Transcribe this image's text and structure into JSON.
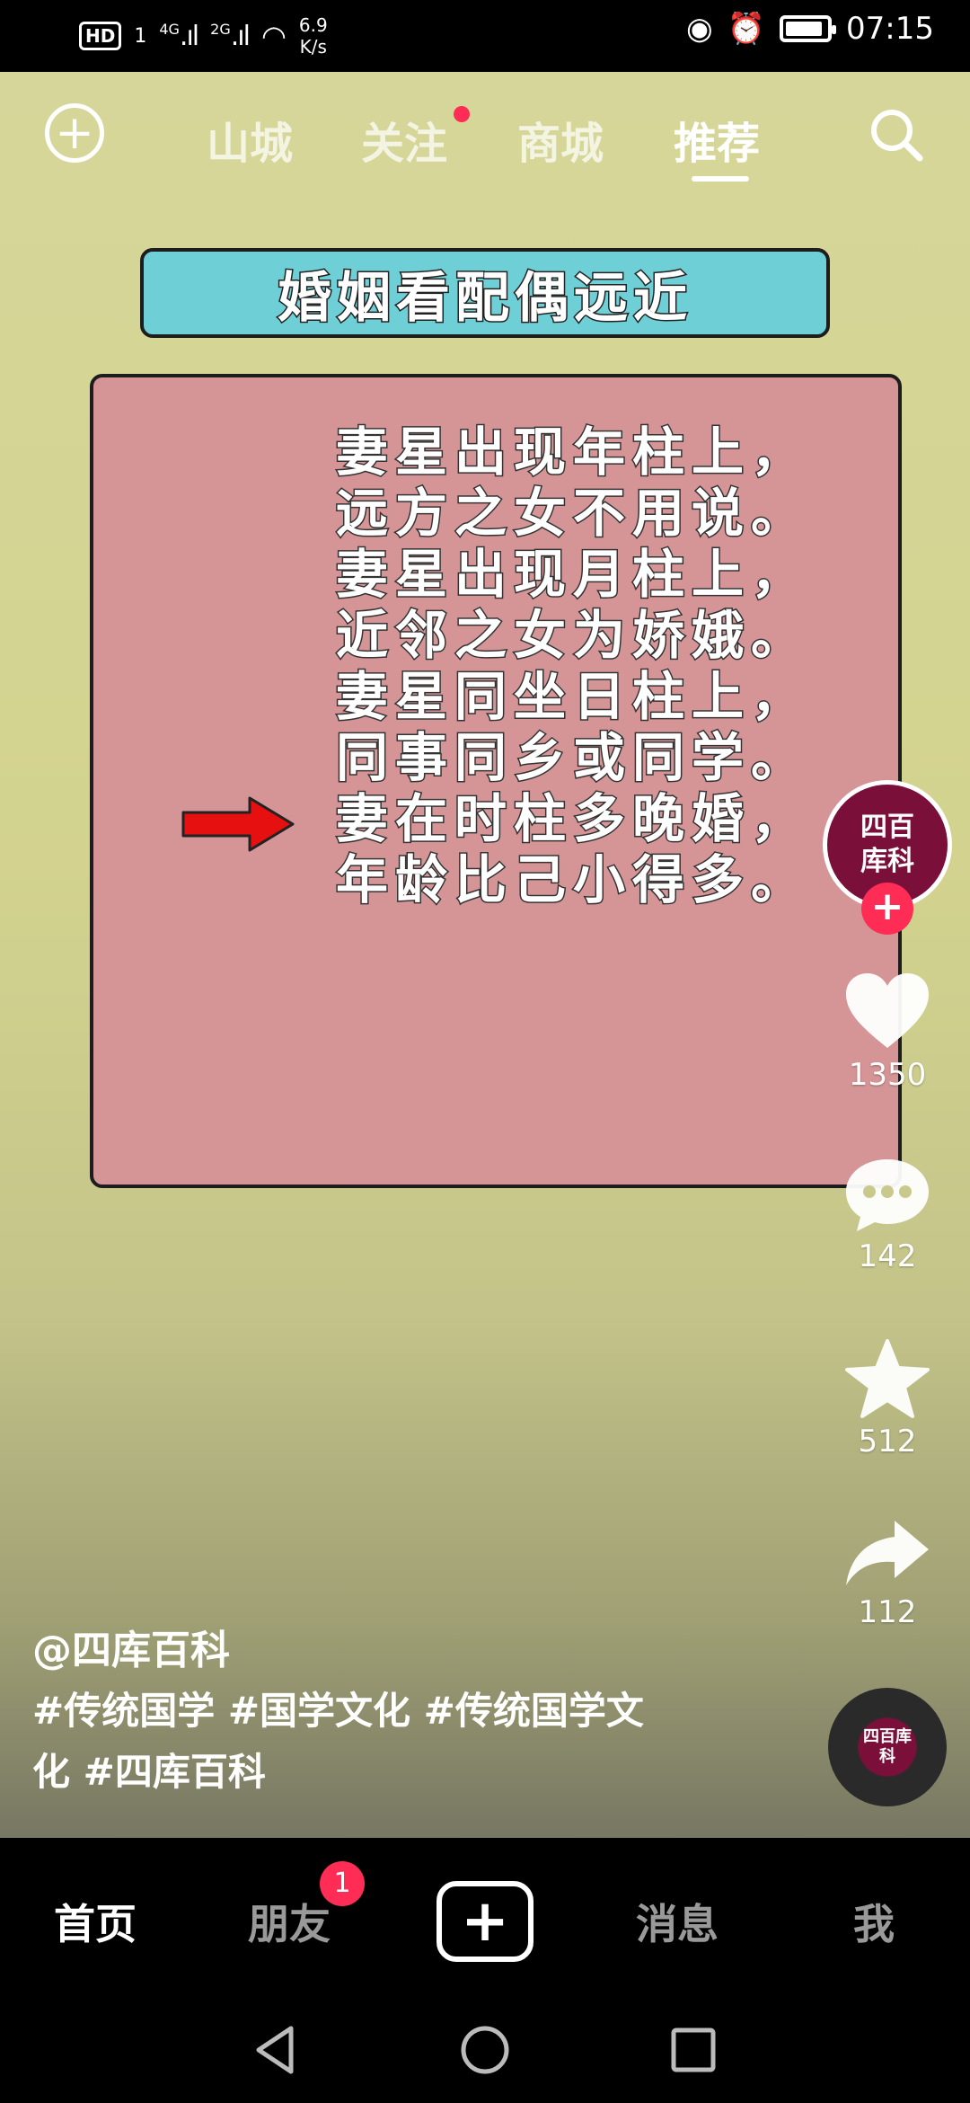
{
  "status_bar": {
    "hd": "HD",
    "sim": "1",
    "sig1": "4G",
    "sig2": "2G",
    "net_rate_value": "6.9",
    "net_rate_unit": "K/s",
    "time": "07:15",
    "battery_level": 0.9
  },
  "top_nav": {
    "tabs": [
      "山城",
      "关注",
      "商城",
      "推荐"
    ],
    "active_tab": "推荐"
  },
  "video": {
    "title": "婚姻看配偶远近",
    "poem_lines": [
      "妻星出现年柱上，",
      "远方之女不用说。",
      "妻星出现月柱上，",
      "近邻之女为娇娥。",
      "妻星同坐日柱上，",
      "同事同乡或同学。",
      "妻在时柱多晚婚，",
      "年龄比己小得多。"
    ]
  },
  "side_actions": {
    "avatar_line1": "四百",
    "avatar_line2": "库科",
    "likes": "1350",
    "comments": "142",
    "favorites": "512",
    "shares": "112"
  },
  "caption": {
    "author": "@四库百科",
    "tags_line1": "#传统国学 #国学文化 #传统国学文",
    "tags_line2": "化 #四库百科"
  },
  "music": {
    "label": "四百库科"
  },
  "bottom_nav": {
    "home": "首页",
    "friends": "朋友",
    "friends_badge": "1",
    "messages": "消息",
    "me": "我"
  },
  "colors": {
    "background": "#d6d69a",
    "banner": "#6ecfd6",
    "card": "#d59596",
    "accent": "#ff2d55"
  }
}
